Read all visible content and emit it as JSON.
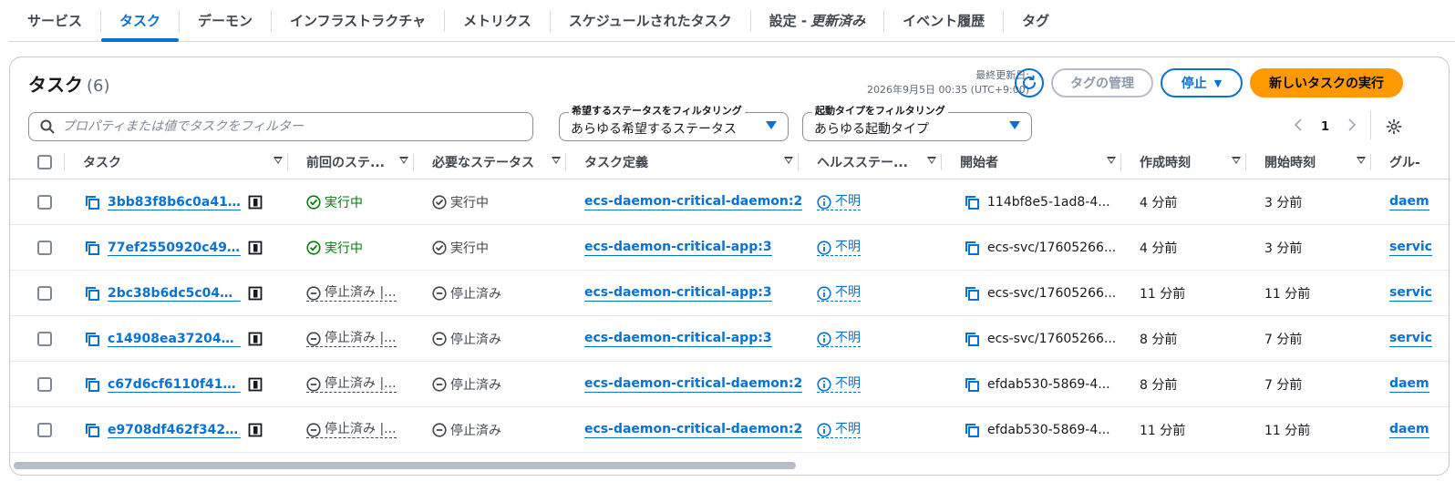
{
  "tabs": [
    {
      "label": "サービス",
      "active": false
    },
    {
      "label": "タスク",
      "active": true
    },
    {
      "label": "デーモン",
      "active": false
    },
    {
      "label": "インフラストラクチャ",
      "active": false
    },
    {
      "label": "メトリクス",
      "active": false
    },
    {
      "label": "スケジュールされたタスク",
      "active": false
    },
    {
      "label": "設定 -",
      "suffix": "更新済み",
      "active": false
    },
    {
      "label": "イベント履歴",
      "active": false
    },
    {
      "label": "タグ",
      "active": false
    }
  ],
  "header": {
    "title": "タスク",
    "count": "(6)",
    "last_updated_label": "最終更新日:",
    "last_updated_value": "2026年9月5日 00:35 (UTC+9:00)",
    "manage_tags": "タグの管理",
    "stop": "停止",
    "run_task": "新しいタスクの実行"
  },
  "filters": {
    "search_placeholder": "プロパティまたは値でタスクをフィルター",
    "desired_status_label": "希望するステータスをフィルタリング",
    "desired_status_value": "あらゆる希望するステータス",
    "launch_type_label": "起動タイプをフィルタリング",
    "launch_type_value": "あらゆる起動タイプ"
  },
  "pagination": {
    "current_page": "1"
  },
  "columns": [
    "タスク",
    "前回のステ...",
    "必要なステータス",
    "タスク定義",
    "ヘルスステー...",
    "開始者",
    "作成時刻",
    "開始時刻",
    "グル-"
  ],
  "rows": [
    {
      "task": "3bb83f8b6c0a418e9...",
      "last_status": "実行中",
      "desired_status": "実行中",
      "task_def": "ecs-daemon-critical-daemon:2",
      "health": "不明",
      "started_by": "114bf8e5-1ad8-4...",
      "created": "4 分前",
      "started": "3 分前",
      "group": "daem"
    },
    {
      "task": "77ef2550920c494c8...",
      "last_status": "実行中",
      "desired_status": "実行中",
      "task_def": "ecs-daemon-critical-app:3",
      "health": "不明",
      "started_by": "ecs-svc/17605266...",
      "created": "4 分前",
      "started": "3 分前",
      "group": "servic"
    },
    {
      "task": "2bc38b6dc5c04dcda...",
      "last_status": "停止済み |...",
      "desired_status": "停止済み",
      "task_def": "ecs-daemon-critical-app:3",
      "health": "不明",
      "started_by": "ecs-svc/17605266...",
      "created": "11 分前",
      "started": "11 分前",
      "group": "servic"
    },
    {
      "task": "c14908ea37204604...",
      "last_status": "停止済み |...",
      "desired_status": "停止済み",
      "task_def": "ecs-daemon-critical-app:3",
      "health": "不明",
      "started_by": "ecs-svc/17605266...",
      "created": "8 分前",
      "started": "7 分前",
      "group": "servic"
    },
    {
      "task": "c67d6cf6110f4147a...",
      "last_status": "停止済み |...",
      "desired_status": "停止済み",
      "task_def": "ecs-daemon-critical-daemon:2",
      "health": "不明",
      "started_by": "efdab530-5869-4...",
      "created": "8 分前",
      "started": "7 分前",
      "group": "daem"
    },
    {
      "task": "e9708df462f34289a...",
      "last_status": "停止済み |...",
      "desired_status": "停止済み",
      "task_def": "ecs-daemon-critical-daemon:2",
      "health": "不明",
      "started_by": "efdab530-5869-4...",
      "created": "11 分前",
      "started": "11 分前",
      "group": "daem"
    }
  ],
  "colors": {
    "accent": "#0972d3",
    "primary_button": "#ff9900",
    "running": "#037f0c"
  }
}
